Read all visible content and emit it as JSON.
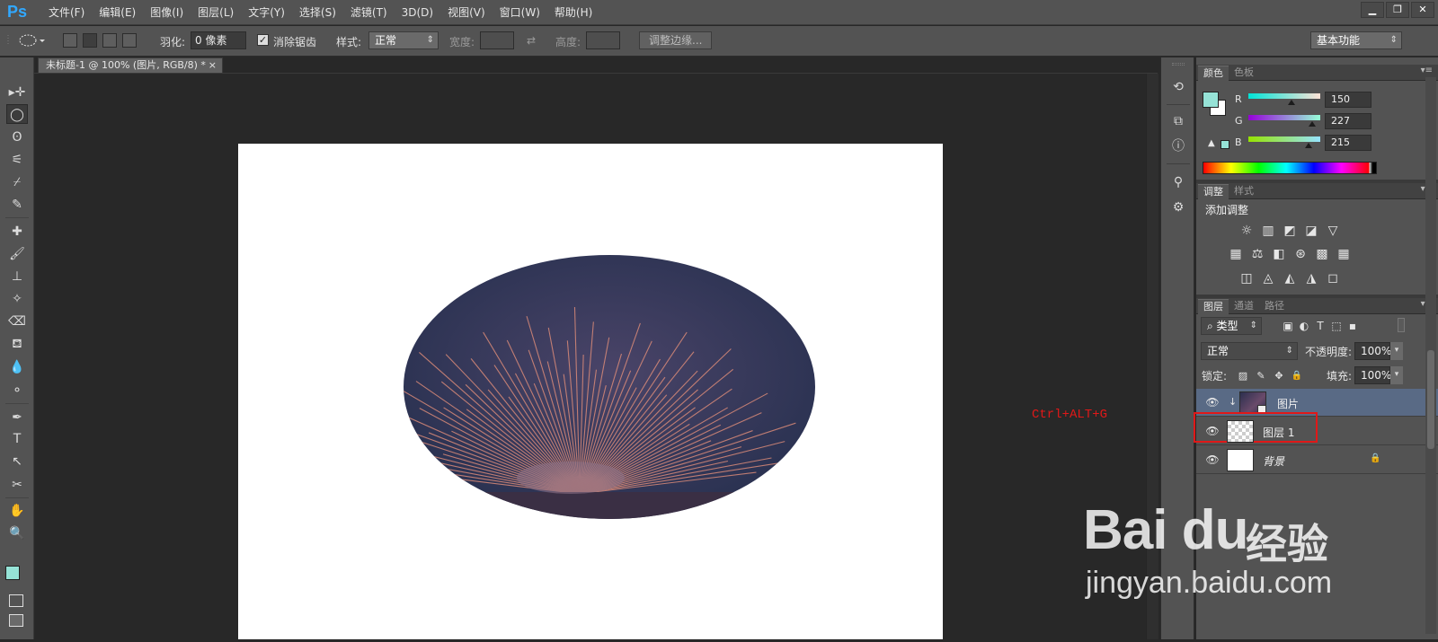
{
  "menubar": {
    "logo": "Ps",
    "items": [
      "文件(F)",
      "编辑(E)",
      "图像(I)",
      "图层(L)",
      "文字(Y)",
      "选择(S)",
      "滤镜(T)",
      "3D(D)",
      "视图(V)",
      "窗口(W)",
      "帮助(H)"
    ],
    "window_buttons": [
      "▁",
      "❐",
      "✕"
    ]
  },
  "options": {
    "feather_label": "羽化:",
    "feather_value": "0 像素",
    "antialias_label": "消除锯齿",
    "antialias_checked": "✓",
    "style_label": "样式:",
    "style_value": "正常",
    "width_label": "宽度:",
    "height_label": "高度:",
    "refine_edge": "调整边缘...",
    "swap_icon": "⇄",
    "workspace": "基本功能"
  },
  "document": {
    "tab_title": "未标题-1 @ 100% (图片, RGB/8) *",
    "tab_close": "×",
    "selection_shape": "ellipse",
    "bg": "#ffffff"
  },
  "annotation": "Ctrl+ALT+G",
  "color_panel": {
    "tabs": [
      "颜色",
      "色板"
    ],
    "menu": "▾≡",
    "r_label": "R",
    "g_label": "G",
    "b_label": "B",
    "r": "150",
    "g": "227",
    "b": "215",
    "foreground": "#96e3d7",
    "background": "#ffffff"
  },
  "adjustments_panel": {
    "tabs": [
      "调整",
      "样式"
    ],
    "menu": "▾≡",
    "title": "添加调整",
    "row1": [
      "☼",
      "▥",
      "◩",
      "◪",
      "▽"
    ],
    "row2": [
      "▦",
      "⚖",
      "◧",
      "⊛",
      "▩"
    ],
    "row3": [
      "◫",
      "◬",
      "◭",
      "◮",
      "◻"
    ]
  },
  "layers_panel": {
    "tabs": [
      "图层",
      "通道",
      "路径"
    ],
    "menu": "▾≡",
    "filter_label": "⌕ 类型",
    "filter_icons": [
      "▣",
      "◐",
      "T",
      "⬚",
      "▪"
    ],
    "blend_mode": "正常",
    "opacity_label": "不透明度:",
    "opacity": "100%",
    "lock_label": "锁定:",
    "lock_icons": [
      "▨",
      "✎",
      "✥",
      "🔒"
    ],
    "fill_label": "填充:",
    "fill": "100%",
    "layers": [
      {
        "name": "图片",
        "clip_icon": "↓",
        "lock": ""
      },
      {
        "name": "图层 1",
        "clip_icon": "",
        "lock": ""
      },
      {
        "name": "背景",
        "clip_icon": "",
        "lock": "🔒"
      }
    ],
    "eye_icon": "👁"
  },
  "dock": {
    "icons": [
      "⟲",
      "⧉",
      "ⓘ",
      "⚲",
      "⚙"
    ]
  },
  "tools": {
    "icons": [
      "▸✛",
      "◯",
      "ʘ",
      "⚟",
      "⌿",
      "✎",
      "✚",
      "🖌",
      "⊥",
      "✧",
      "⌫",
      "⛾",
      "💧",
      "⚬",
      "✒",
      "T",
      "↖",
      "✂",
      "✋",
      "🔍"
    ]
  },
  "watermark": {
    "logo": "Bai du",
    "cn": "经验",
    "url": "jingyan.baidu.com"
  }
}
